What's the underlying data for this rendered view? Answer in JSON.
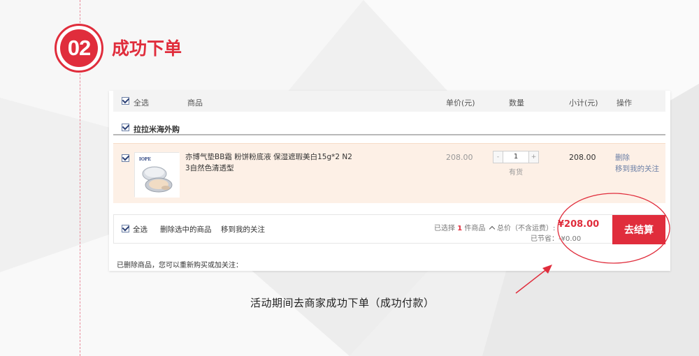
{
  "step": {
    "number": "02",
    "title": "成功下单"
  },
  "cart": {
    "header": {
      "select_all": "全选",
      "product": "商品",
      "unit_price": "单价(元)",
      "quantity": "数量",
      "subtotal": "小计(元)",
      "actions": "操作"
    },
    "store_name": "拉拉米海外购",
    "item": {
      "brand": "IOPE",
      "name_line1": "亦博气垫BB霜 粉饼粉底液 保湿遮瑕美白15g*2 N2",
      "name_line2": "3自然色清透型",
      "price": "208.00",
      "qty_minus": "-",
      "qty": "1",
      "qty_plus": "+",
      "stock": "有货",
      "subtotal": "208.00",
      "delete": "删除",
      "move_to_favorites": "移到我的关注"
    },
    "footer": {
      "select_all": "全选",
      "delete_selected": "删除选中的商品",
      "move_to_favorites": "移到我的关注",
      "selected_prefix": "已选择",
      "selected_count": "1",
      "selected_suffix": "件商品",
      "total_label": "总价（不含运费）:",
      "total_amount": "¥208.00",
      "saved": "已节省：-¥0.00",
      "checkout": "去结算"
    },
    "removed_note": "已删除商品，您可以重新购买或加关注："
  },
  "caption": "活动期间去商家成功下单（成功付款）",
  "colors": {
    "accent": "#e02d3c",
    "link": "#6b7fa6",
    "row_highlight": "#fdf0e6"
  }
}
